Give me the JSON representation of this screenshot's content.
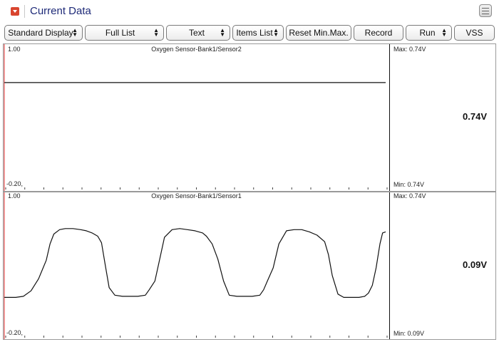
{
  "window": {
    "title": "Current Data",
    "collapse_icon": "collapse-arrow-icon",
    "menu_icon": "menu-icon"
  },
  "toolbar": {
    "buttons": [
      {
        "label": "Standard Display",
        "dropdown": true
      },
      {
        "label": "Full List",
        "dropdown": true
      },
      {
        "label": "Text",
        "dropdown": true
      },
      {
        "label": "Items List",
        "dropdown": true
      },
      {
        "label": "Reset Min.Max.",
        "dropdown": false
      },
      {
        "label": "Record",
        "dropdown": false
      },
      {
        "label": "Run",
        "dropdown": true
      },
      {
        "label": "VSS",
        "dropdown": false
      }
    ]
  },
  "panes": [
    {
      "sensor": "Oxygen Sensor-Bank1/Sensor2",
      "y_max_label": "1.00",
      "y_min_label": "-0.20,",
      "max_text": "Max:  0.74V",
      "min_text": "Min:  0.74V",
      "current_value": "0.74V"
    },
    {
      "sensor": "Oxygen Sensor-Bank1/Sensor1",
      "y_max_label": "1.00",
      "y_min_label": "-0.20,",
      "max_text": "Max:  0.74V",
      "min_text": "Min:  0.09V",
      "current_value": "0.09V"
    }
  ],
  "chart_data": [
    {
      "type": "line",
      "title": "Oxygen Sensor-Bank1/Sensor2",
      "ylim": [
        -0.2,
        1.0
      ],
      "x": [
        0,
        100
      ],
      "series": [
        {
          "values": [
            0.74,
            0.74
          ]
        }
      ]
    },
    {
      "type": "line",
      "title": "Oxygen Sensor-Bank1/Sensor1",
      "ylim": [
        -0.2,
        1.0
      ],
      "x": [
        0,
        1.5,
        3,
        5,
        7,
        9,
        11,
        12,
        13,
        14.5,
        16,
        18,
        20,
        21.5,
        23,
        24.5,
        25.5,
        26.5,
        27.5,
        29,
        31,
        33,
        35,
        37,
        38,
        39.5,
        40.5,
        42,
        44,
        46,
        48,
        50,
        52,
        53,
        54.5,
        56,
        57.5,
        59,
        61,
        63,
        65,
        67,
        68,
        69,
        70.5,
        72,
        74,
        76,
        78,
        80,
        82,
        84,
        85,
        86,
        87.5,
        89,
        91,
        93,
        94.5,
        95.5,
        96.5,
        97.5,
        98.5,
        99.2,
        100
      ],
      "series": [
        {
          "values": [
            0.13,
            0.13,
            0.13,
            0.14,
            0.19,
            0.3,
            0.47,
            0.62,
            0.71,
            0.75,
            0.76,
            0.76,
            0.75,
            0.74,
            0.72,
            0.69,
            0.63,
            0.42,
            0.22,
            0.15,
            0.14,
            0.14,
            0.14,
            0.15,
            0.2,
            0.28,
            0.44,
            0.68,
            0.75,
            0.76,
            0.75,
            0.74,
            0.72,
            0.69,
            0.62,
            0.48,
            0.28,
            0.15,
            0.14,
            0.14,
            0.14,
            0.15,
            0.2,
            0.28,
            0.4,
            0.62,
            0.74,
            0.75,
            0.75,
            0.73,
            0.7,
            0.64,
            0.52,
            0.33,
            0.16,
            0.13,
            0.13,
            0.13,
            0.14,
            0.17,
            0.24,
            0.4,
            0.62,
            0.72,
            0.73
          ]
        }
      ]
    }
  ],
  "colors": {
    "title": "#1e2a78",
    "accent_icon": "#d9452f",
    "trace": "#111111",
    "cursor_line": "#e03030"
  }
}
